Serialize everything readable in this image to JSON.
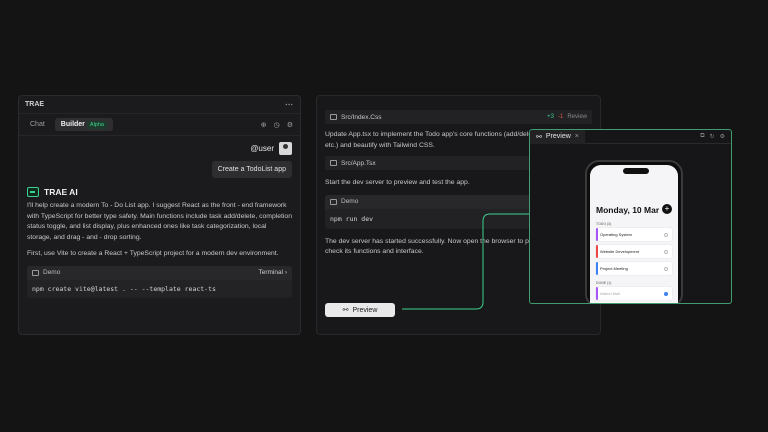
{
  "left": {
    "title": "TRAE",
    "more_icon": "⋯",
    "tabs": [
      {
        "label": "Chat"
      },
      {
        "label": "Builder"
      }
    ],
    "badge": "Alpha",
    "user_name": "@user",
    "user_message": "Create a TodoList app",
    "ai_name": "TRAE AI",
    "ai_paragraph1": "I'll help create a modern To - Do List app. I suggest React as the front - end framework with TypeScript for better type safety. Main functions include task add/delete, completion status toggle, and list display, plus enhanced ones like task categorization, local storage, and drag - and - drop sorting.",
    "ai_paragraph2": "First, use Vite to create a React + TypeScript project for a modern dev environment.",
    "code_label": "Demo",
    "terminal_label": "Terminal ›",
    "code": "npm create vite@latest . -- --template react-ts"
  },
  "middle": {
    "file1": "Src/Index.Css",
    "diff_plus": "+3",
    "diff_minus": "-1",
    "review": "Review",
    "para1": "Update App.tsx to implement the Todo app's core functions (add/delete/status toggle, etc.) and beautify with Tailwind CSS.",
    "file2": "Src/App.Tsx",
    "para2": "Start the dev server to preview and test the app.",
    "demo_label": "Demo",
    "demo_code": "npm run dev",
    "para3": "The dev server has started successfully. Now open the browser to preview the app and check its functions and interface.",
    "preview_button": "Preview"
  },
  "preview": {
    "tab_label": "Preview",
    "close": "×",
    "date": "Monday, 10 Mar",
    "add": "+",
    "todo_label": "TODO (3)",
    "done_label": "DONE (1)",
    "tasks": [
      {
        "name": "Operating System",
        "color": "#a855f7"
      },
      {
        "name": "Website Development",
        "color": "#ef4444"
      },
      {
        "name": "Project Meeting",
        "color": "#3b82f6"
      }
    ],
    "done_task": "Attend Mail"
  },
  "colors": {
    "accent": "#3ecf8e",
    "panel_border": "#3f9d6f"
  }
}
